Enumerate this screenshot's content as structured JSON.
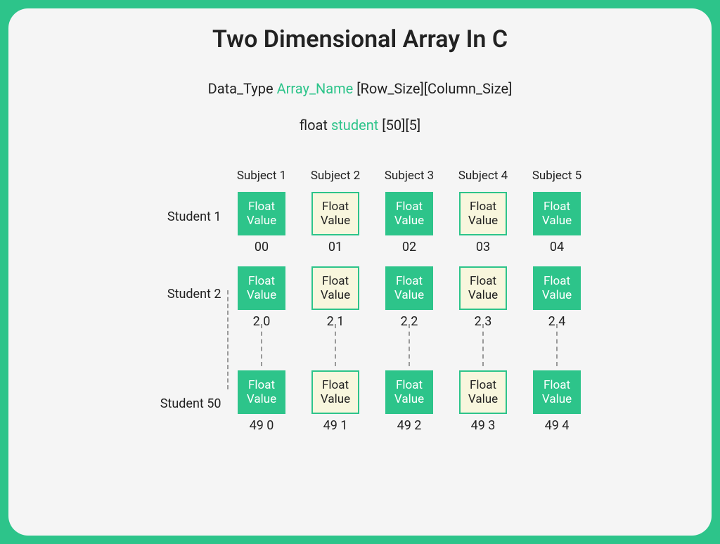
{
  "title": "Two Dimensional Array In C",
  "syntax": {
    "part1": "Data_Type ",
    "name": "Array_Name",
    "part2": " [Row_Size][Column_Size]"
  },
  "example": {
    "part1": "float ",
    "name": "student",
    "part2": " [50][5]"
  },
  "col_headers": [
    "Subject 1",
    "Subject 2",
    "Subject 3",
    "Subject 4",
    "Subject 5"
  ],
  "row_labels": [
    "Student 1",
    "Student 2",
    "Student 50"
  ],
  "cell_text": {
    "line1": "Float",
    "line2": "Value"
  },
  "indices": {
    "row0": [
      "00",
      "01",
      "02",
      "03",
      "04"
    ],
    "row1": [
      "2 0",
      "2 1",
      "2 2",
      "2 3",
      "2 4"
    ],
    "row2": [
      "49 0",
      "49 1",
      "49 2",
      "49 3",
      "49 4"
    ]
  },
  "cell_styles": [
    "green",
    "cream",
    "green",
    "cream",
    "green"
  ]
}
